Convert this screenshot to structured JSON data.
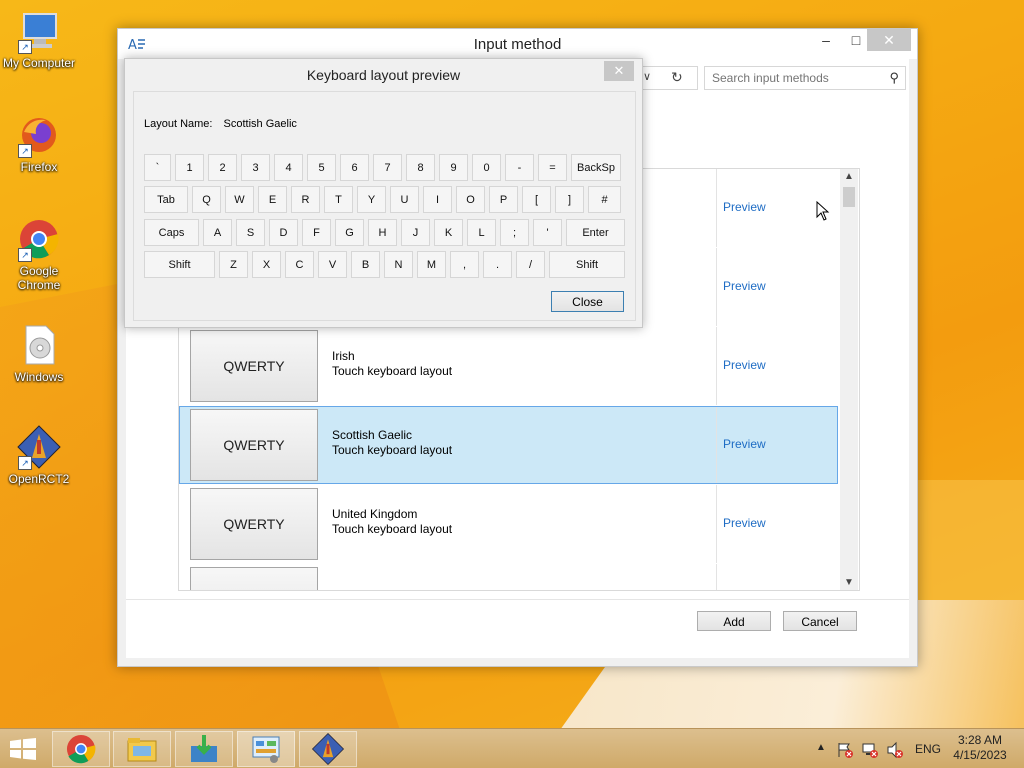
{
  "desktop": {
    "icons": [
      {
        "label": "My Computer"
      },
      {
        "label": "Firefox"
      },
      {
        "label": "Google Chrome"
      },
      {
        "label": "Windows"
      },
      {
        "label": "OpenRCT2"
      }
    ]
  },
  "window": {
    "title": "Input method",
    "search_placeholder": "Search input methods",
    "rows": [
      {
        "thumb": "",
        "name": "",
        "sub": "",
        "preview": "Preview"
      },
      {
        "thumb": "",
        "name": "",
        "sub": "",
        "preview": "Preview"
      },
      {
        "thumb": "QWERTY",
        "name": "Irish",
        "sub": "Touch keyboard layout",
        "preview": "Preview"
      },
      {
        "thumb": "QWERTY",
        "name": "Scottish Gaelic",
        "sub": "Touch keyboard layout",
        "preview": "Preview"
      },
      {
        "thumb": "QWERTY",
        "name": "United Kingdom",
        "sub": "Touch keyboard layout",
        "preview": "Preview"
      }
    ],
    "add_label": "Add",
    "cancel_label": "Cancel"
  },
  "dialog": {
    "title": "Keyboard layout preview",
    "layout_name_label": "Layout Name:",
    "layout_name_value": "Scottish Gaelic",
    "close_label": "Close",
    "keys": {
      "row1": [
        "`",
        "1",
        "2",
        "3",
        "4",
        "5",
        "6",
        "7",
        "8",
        "9",
        "0",
        "-",
        "=",
        "BackSp"
      ],
      "row2": [
        "Tab",
        "Q",
        "W",
        "E",
        "R",
        "T",
        "Y",
        "U",
        "I",
        "O",
        "P",
        "[",
        "]",
        "#"
      ],
      "row3": [
        "Caps",
        "A",
        "S",
        "D",
        "F",
        "G",
        "H",
        "J",
        "K",
        "L",
        ";",
        "'",
        "Enter"
      ],
      "row4": [
        "Shift",
        "Z",
        "X",
        "C",
        "V",
        "B",
        "N",
        "M",
        ",",
        ".",
        "/",
        "Shift"
      ]
    }
  },
  "taskbar": {
    "lang": "ENG",
    "time": "3:28 AM",
    "date": "4/15/2023"
  }
}
